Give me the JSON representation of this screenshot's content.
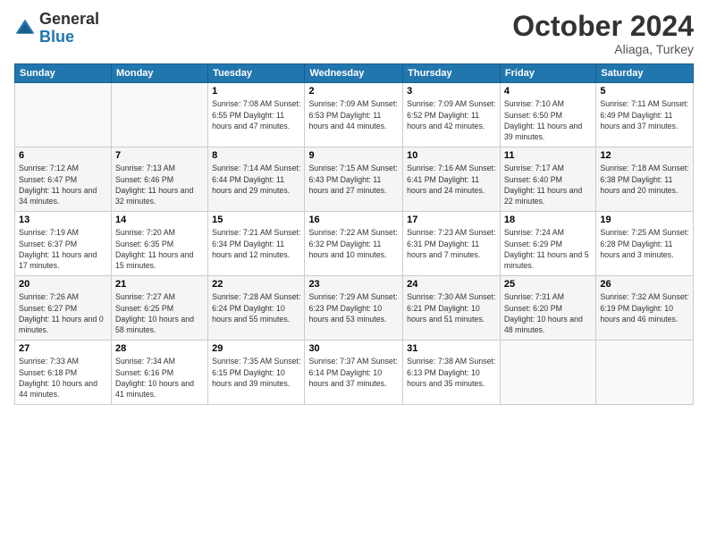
{
  "header": {
    "logo": {
      "line1": "General",
      "line2": "Blue"
    },
    "title": "October 2024",
    "subtitle": "Aliaga, Turkey"
  },
  "weekdays": [
    "Sunday",
    "Monday",
    "Tuesday",
    "Wednesday",
    "Thursday",
    "Friday",
    "Saturday"
  ],
  "weeks": [
    [
      {
        "day": "",
        "info": ""
      },
      {
        "day": "",
        "info": ""
      },
      {
        "day": "1",
        "info": "Sunrise: 7:08 AM\nSunset: 6:55 PM\nDaylight: 11 hours and 47 minutes."
      },
      {
        "day": "2",
        "info": "Sunrise: 7:09 AM\nSunset: 6:53 PM\nDaylight: 11 hours and 44 minutes."
      },
      {
        "day": "3",
        "info": "Sunrise: 7:09 AM\nSunset: 6:52 PM\nDaylight: 11 hours and 42 minutes."
      },
      {
        "day": "4",
        "info": "Sunrise: 7:10 AM\nSunset: 6:50 PM\nDaylight: 11 hours and 39 minutes."
      },
      {
        "day": "5",
        "info": "Sunrise: 7:11 AM\nSunset: 6:49 PM\nDaylight: 11 hours and 37 minutes."
      }
    ],
    [
      {
        "day": "6",
        "info": "Sunrise: 7:12 AM\nSunset: 6:47 PM\nDaylight: 11 hours and 34 minutes."
      },
      {
        "day": "7",
        "info": "Sunrise: 7:13 AM\nSunset: 6:46 PM\nDaylight: 11 hours and 32 minutes."
      },
      {
        "day": "8",
        "info": "Sunrise: 7:14 AM\nSunset: 6:44 PM\nDaylight: 11 hours and 29 minutes."
      },
      {
        "day": "9",
        "info": "Sunrise: 7:15 AM\nSunset: 6:43 PM\nDaylight: 11 hours and 27 minutes."
      },
      {
        "day": "10",
        "info": "Sunrise: 7:16 AM\nSunset: 6:41 PM\nDaylight: 11 hours and 24 minutes."
      },
      {
        "day": "11",
        "info": "Sunrise: 7:17 AM\nSunset: 6:40 PM\nDaylight: 11 hours and 22 minutes."
      },
      {
        "day": "12",
        "info": "Sunrise: 7:18 AM\nSunset: 6:38 PM\nDaylight: 11 hours and 20 minutes."
      }
    ],
    [
      {
        "day": "13",
        "info": "Sunrise: 7:19 AM\nSunset: 6:37 PM\nDaylight: 11 hours and 17 minutes."
      },
      {
        "day": "14",
        "info": "Sunrise: 7:20 AM\nSunset: 6:35 PM\nDaylight: 11 hours and 15 minutes."
      },
      {
        "day": "15",
        "info": "Sunrise: 7:21 AM\nSunset: 6:34 PM\nDaylight: 11 hours and 12 minutes."
      },
      {
        "day": "16",
        "info": "Sunrise: 7:22 AM\nSunset: 6:32 PM\nDaylight: 11 hours and 10 minutes."
      },
      {
        "day": "17",
        "info": "Sunrise: 7:23 AM\nSunset: 6:31 PM\nDaylight: 11 hours and 7 minutes."
      },
      {
        "day": "18",
        "info": "Sunrise: 7:24 AM\nSunset: 6:29 PM\nDaylight: 11 hours and 5 minutes."
      },
      {
        "day": "19",
        "info": "Sunrise: 7:25 AM\nSunset: 6:28 PM\nDaylight: 11 hours and 3 minutes."
      }
    ],
    [
      {
        "day": "20",
        "info": "Sunrise: 7:26 AM\nSunset: 6:27 PM\nDaylight: 11 hours and 0 minutes."
      },
      {
        "day": "21",
        "info": "Sunrise: 7:27 AM\nSunset: 6:25 PM\nDaylight: 10 hours and 58 minutes."
      },
      {
        "day": "22",
        "info": "Sunrise: 7:28 AM\nSunset: 6:24 PM\nDaylight: 10 hours and 55 minutes."
      },
      {
        "day": "23",
        "info": "Sunrise: 7:29 AM\nSunset: 6:23 PM\nDaylight: 10 hours and 53 minutes."
      },
      {
        "day": "24",
        "info": "Sunrise: 7:30 AM\nSunset: 6:21 PM\nDaylight: 10 hours and 51 minutes."
      },
      {
        "day": "25",
        "info": "Sunrise: 7:31 AM\nSunset: 6:20 PM\nDaylight: 10 hours and 48 minutes."
      },
      {
        "day": "26",
        "info": "Sunrise: 7:32 AM\nSunset: 6:19 PM\nDaylight: 10 hours and 46 minutes."
      }
    ],
    [
      {
        "day": "27",
        "info": "Sunrise: 7:33 AM\nSunset: 6:18 PM\nDaylight: 10 hours and 44 minutes."
      },
      {
        "day": "28",
        "info": "Sunrise: 7:34 AM\nSunset: 6:16 PM\nDaylight: 10 hours and 41 minutes."
      },
      {
        "day": "29",
        "info": "Sunrise: 7:35 AM\nSunset: 6:15 PM\nDaylight: 10 hours and 39 minutes."
      },
      {
        "day": "30",
        "info": "Sunrise: 7:37 AM\nSunset: 6:14 PM\nDaylight: 10 hours and 37 minutes."
      },
      {
        "day": "31",
        "info": "Sunrise: 7:38 AM\nSunset: 6:13 PM\nDaylight: 10 hours and 35 minutes."
      },
      {
        "day": "",
        "info": ""
      },
      {
        "day": "",
        "info": ""
      }
    ]
  ]
}
